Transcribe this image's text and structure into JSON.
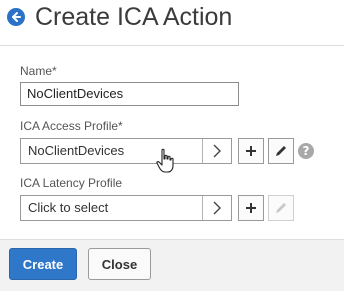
{
  "header": {
    "title": "Create ICA Action",
    "back_icon": "arrow-left-icon"
  },
  "form": {
    "name": {
      "label": "Name*",
      "value": "NoClientDevices"
    },
    "access_profile": {
      "label": "ICA Access Profile*",
      "value": "NoClientDevices"
    },
    "latency_profile": {
      "label": "ICA Latency Profile",
      "placeholder": "Click to select"
    },
    "help_glyph": "?"
  },
  "footer": {
    "create_label": "Create",
    "close_label": "Close"
  },
  "colors": {
    "accent": "#2f77c9",
    "panel_bg": "#ffffff",
    "footer_bg": "#f2f2f2"
  }
}
